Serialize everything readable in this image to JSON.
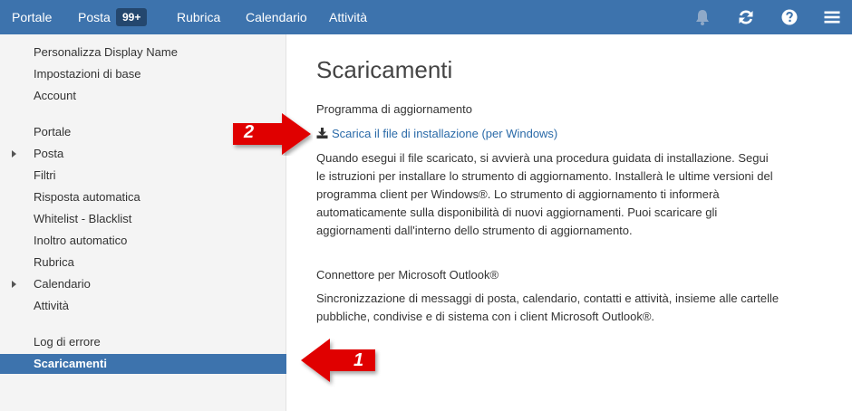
{
  "topbar": {
    "nav": [
      {
        "label": "Portale"
      },
      {
        "label": "Posta"
      },
      {
        "label": "Rubrica"
      },
      {
        "label": "Calendario"
      },
      {
        "label": "Attività"
      }
    ],
    "mail_badge": "99+",
    "icons": [
      "bell-icon",
      "refresh-icon",
      "help-icon",
      "menu-icon"
    ],
    "color": "#3d73ad"
  },
  "sidebar": {
    "items": [
      {
        "label": "Personalizza Display Name"
      },
      {
        "label": "Impostazioni di base"
      },
      {
        "label": "Account"
      },
      {
        "label": "Portale"
      },
      {
        "label": "Posta"
      },
      {
        "label": "Filtri"
      },
      {
        "label": "Risposta automatica"
      },
      {
        "label": "Whitelist - Blacklist"
      },
      {
        "label": "Inoltro automatico"
      },
      {
        "label": "Rubrica"
      },
      {
        "label": "Calendario"
      },
      {
        "label": "Attività"
      },
      {
        "label": "Log di errore"
      },
      {
        "label": "Scaricamenti"
      }
    ],
    "active_item": "Scaricamenti"
  },
  "main": {
    "title": "Scaricamenti",
    "updater": {
      "heading": "Programma di aggiornamento",
      "link": "Scarica il file di installazione (per Windows)",
      "lines": [
        "Quando esegui il file scaricato, si avvierà una procedura guidata di installazione. Segui",
        "le istruzioni per installare lo strumento di aggiornamento. Installerà le ultime versioni del",
        "programma client per Windows®. Lo strumento di aggiornamento ti informerà",
        "automaticamente sulla disponibilità di nuovi aggiornamenti. Puoi scaricare gli",
        "aggiornamenti dall'interno dello strumento di aggiornamento."
      ]
    },
    "outlook": {
      "heading": "Connettore per Microsoft Outlook®",
      "lines": [
        "Sincronizzazione di messaggi di posta, calendario, contatti e attività, insieme alle cartelle",
        "pubbliche, condivise e di sistema con i client Microsoft Outlook®."
      ]
    }
  },
  "annotations": {
    "arrow_1": "1",
    "arrow_2": "2",
    "color": "#e00000"
  }
}
